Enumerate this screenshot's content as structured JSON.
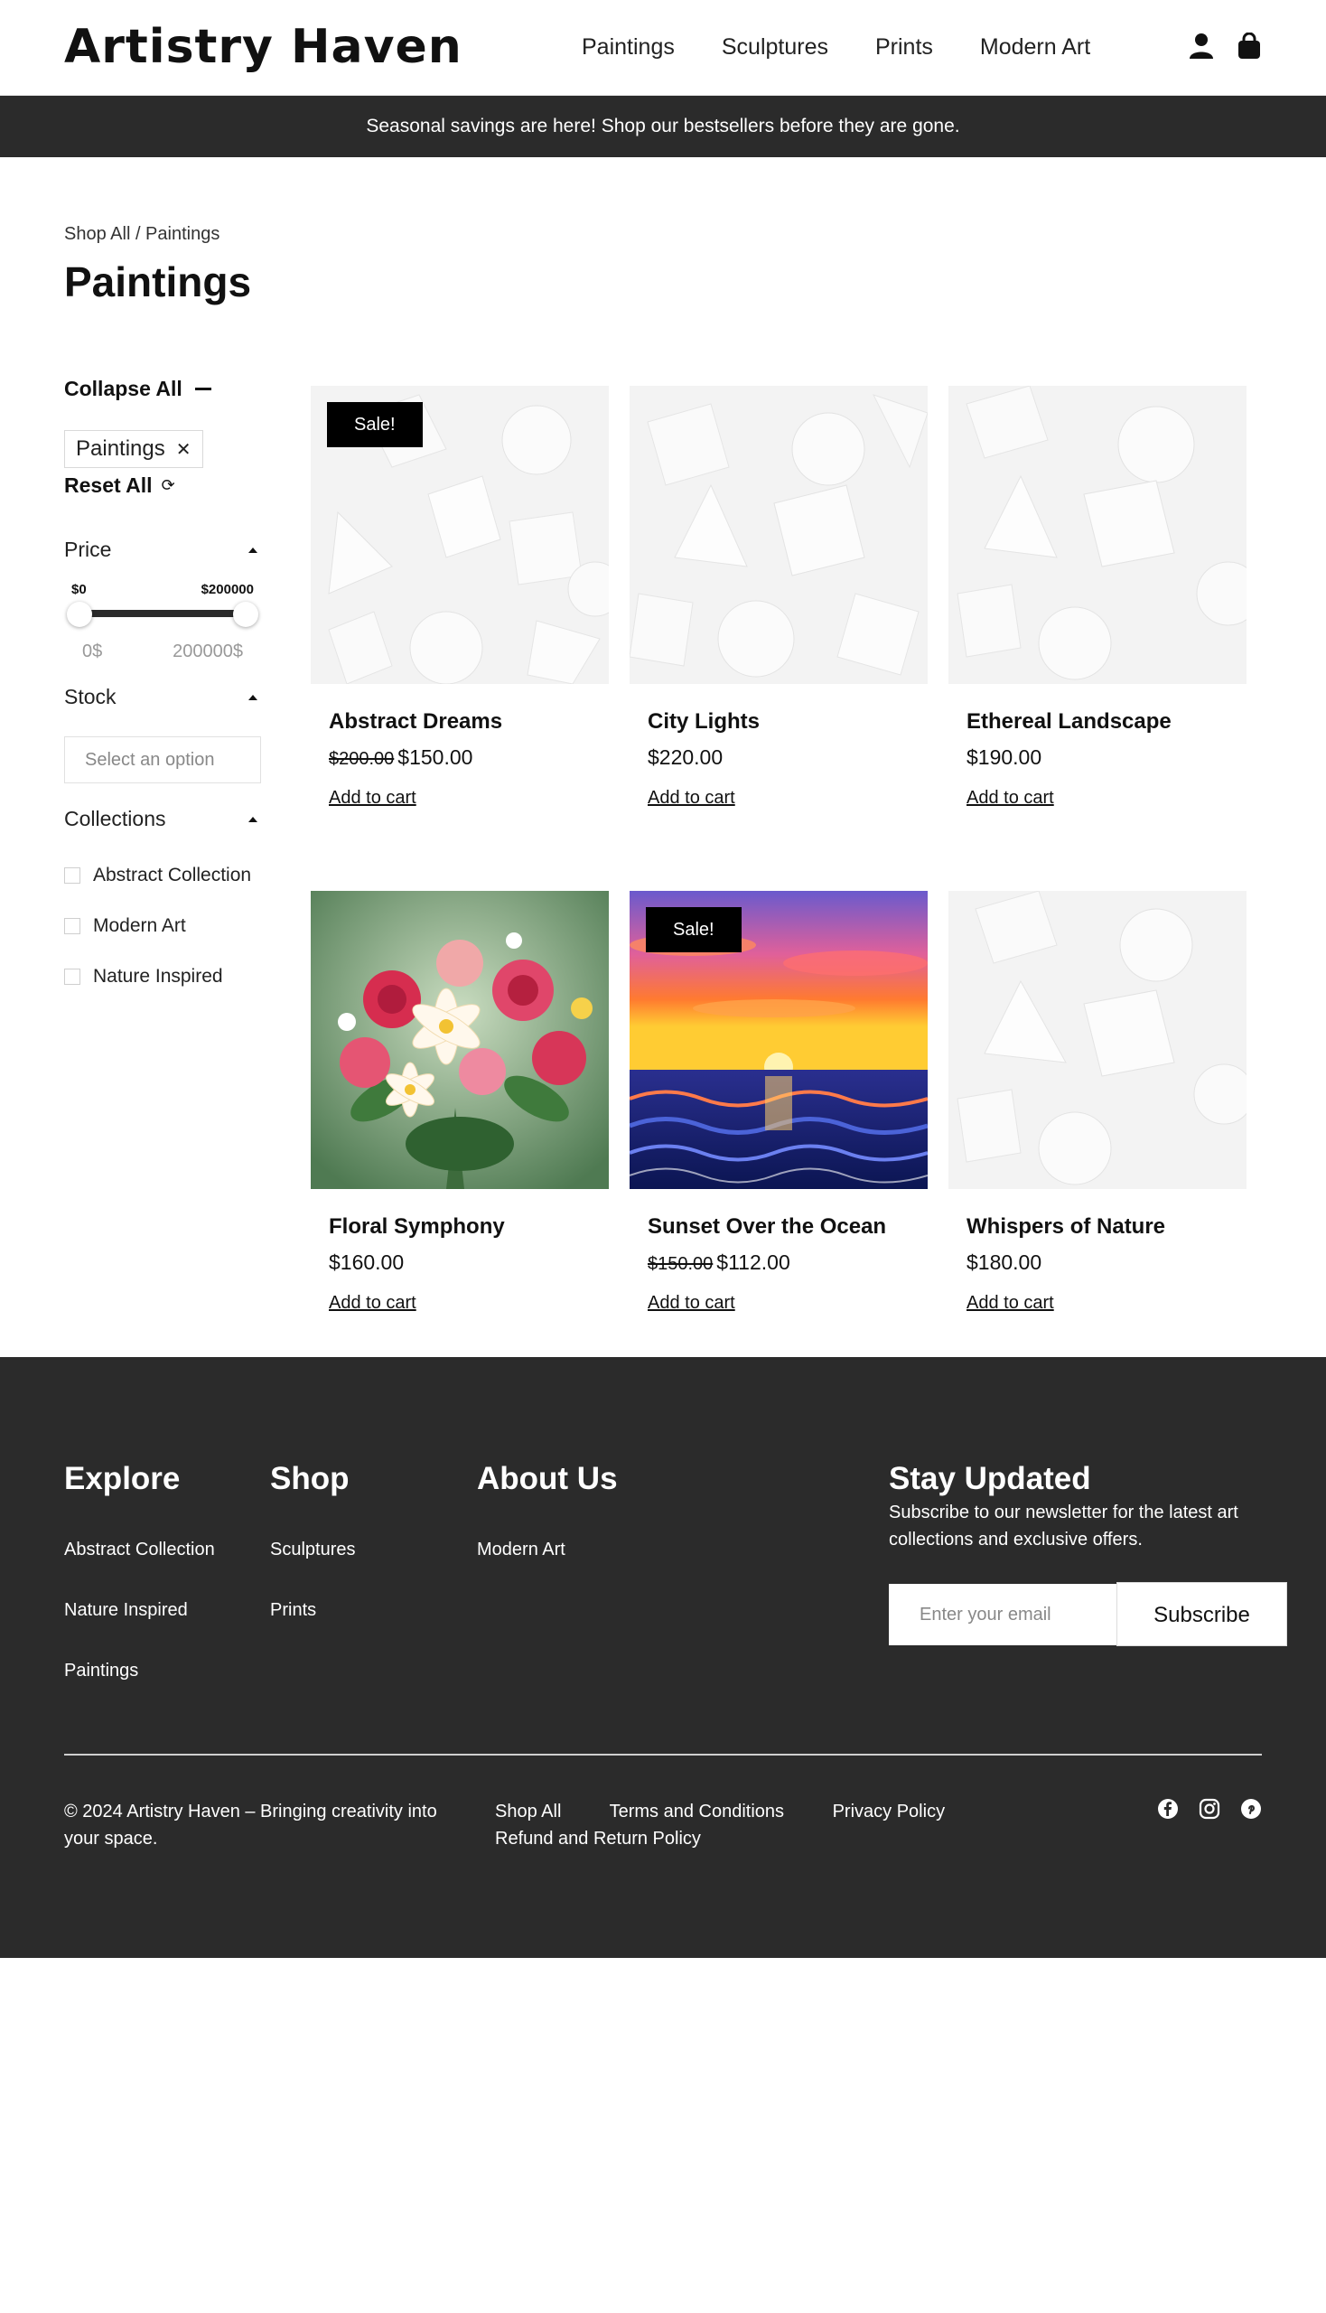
{
  "header": {
    "logo": "Artistry Haven",
    "nav": [
      "Paintings",
      "Sculptures",
      "Prints",
      "Modern Art"
    ],
    "icons": [
      "account-icon",
      "cart-bag-icon"
    ]
  },
  "announcement": "Seasonal savings are here! Shop our bestsellers before they are gone.",
  "breadcrumb": "Shop All / Paintings",
  "page_title": "Paintings",
  "sidebar": {
    "collapse_all": "Collapse All",
    "active_filter": "Paintings",
    "reset_all": "Reset All",
    "price": {
      "label": "Price",
      "min_label": "$0",
      "max_label": "$200000",
      "min_input": "0$",
      "max_input": "200000$"
    },
    "stock": {
      "label": "Stock",
      "placeholder": "Select an option"
    },
    "collections": {
      "label": "Collections",
      "items": [
        "Abstract Collection",
        "Modern Art",
        "Nature Inspired"
      ]
    }
  },
  "products": [
    {
      "name": "Abstract Dreams",
      "old_price": "$200.00",
      "price": "$150.00",
      "sale": "Sale!",
      "cart": "Add to cart",
      "image": "white-geometric-shapes"
    },
    {
      "name": "City Lights",
      "old_price": "",
      "price": "$220.00",
      "sale": "",
      "cart": "Add to cart",
      "image": "white-geometric-shapes"
    },
    {
      "name": "Ethereal Landscape",
      "old_price": "",
      "price": "$190.00",
      "sale": "",
      "cart": "Add to cart",
      "image": "white-geometric-shapes"
    },
    {
      "name": "Floral Symphony",
      "old_price": "",
      "price": "$160.00",
      "sale": "",
      "cart": "Add to cart",
      "image": "flower-bouquet"
    },
    {
      "name": "Sunset Over the Ocean",
      "old_price": "$150.00",
      "price": "$112.00",
      "sale": "Sale!",
      "cart": "Add to cart",
      "image": "sunset-ocean"
    },
    {
      "name": "Whispers of Nature",
      "old_price": "",
      "price": "$180.00",
      "sale": "",
      "cart": "Add to cart",
      "image": "white-geometric-shapes"
    }
  ],
  "footer": {
    "explore": {
      "title": "Explore",
      "links": [
        "Abstract Collection",
        "Nature Inspired",
        "Paintings"
      ]
    },
    "shop": {
      "title": "Shop",
      "links": [
        "Sculptures",
        "Prints"
      ]
    },
    "about": {
      "title": "About Us",
      "links": [
        "Modern Art"
      ]
    },
    "newsletter": {
      "title": "Stay Updated",
      "text": "Subscribe to our newsletter for the latest art collections and exclusive offers.",
      "placeholder": "Enter your email",
      "button": "Subscribe"
    },
    "copyright": "© 2024 Artistry Haven – Bringing creativity into your space.",
    "legal_links": [
      "Shop All",
      "Terms and Conditions",
      "Privacy Policy",
      "Refund and Return Policy"
    ],
    "social": [
      "facebook-icon",
      "instagram-icon",
      "pinterest-icon"
    ]
  },
  "colors": {
    "dark": "#2b2b2b",
    "sale_badge": "#000000",
    "white": "#ffffff"
  }
}
